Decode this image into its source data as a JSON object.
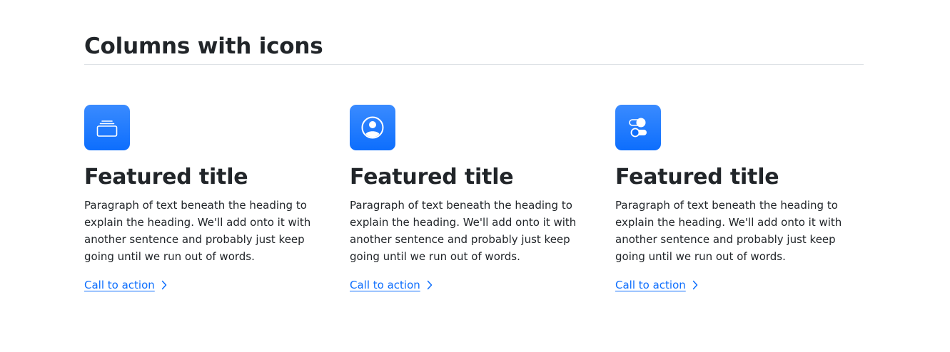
{
  "section": {
    "title": "Columns with icons"
  },
  "colors": {
    "accent": "#0d6efd",
    "icon_bg_top": "#3a8bff",
    "divider": "#dee2e6",
    "text": "#212529"
  },
  "features": [
    {
      "icon": "collection-icon",
      "title": "Featured title",
      "text": "Paragraph of text beneath the heading to explain the heading. We'll add onto it with another sentence and probably just keep going until we run out of words.",
      "cta_label": "Call to action"
    },
    {
      "icon": "person-circle-icon",
      "title": "Featured title",
      "text": "Paragraph of text beneath the heading to explain the heading. We'll add onto it with another sentence and probably just keep going until we run out of words.",
      "cta_label": "Call to action"
    },
    {
      "icon": "toggles-icon",
      "title": "Featured title",
      "text": "Paragraph of text beneath the heading to explain the heading. We'll add onto it with another sentence and probably just keep going until we run out of words.",
      "cta_label": "Call to action"
    }
  ]
}
